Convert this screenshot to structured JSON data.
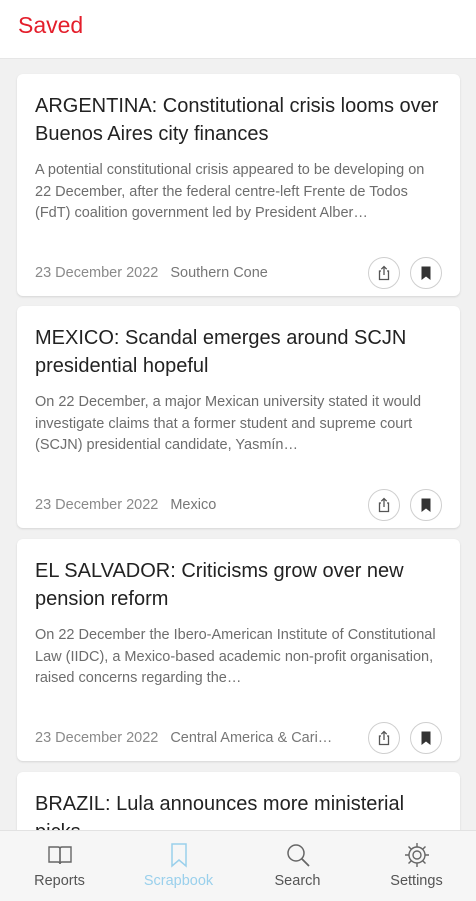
{
  "header": {
    "title": "Saved"
  },
  "colors": {
    "accent": "#e41e2b",
    "active_tab": "#9ad0ec"
  },
  "articles": [
    {
      "title": "ARGENTINA: Constitutional crisis looms over Buenos Aires city finances",
      "summary": "A potential constitutional crisis appeared to be developing on 22 December, after the federal centre-left Frente de Todos (FdT) coalition government led by President Alber…",
      "date": "23 December 2022",
      "region": "Southern Cone"
    },
    {
      "title": "MEXICO: Scandal emerges around SCJN presidential hopeful",
      "summary": "On 22 December, a major Mexican university stated it would investigate claims that a former student and supreme court (SCJN) presidential candidate, Yasmín…",
      "date": "23 December 2022",
      "region": "Mexico"
    },
    {
      "title": "EL SALVADOR: Criticisms grow over new pension reform",
      "summary": "On 22 December the Ibero-American Institute of Constitutional Law (IIDC), a Mexico-based academic non-profit organisation, raised concerns regarding the…",
      "date": "23 December 2022",
      "region": "Central America & Caribbean"
    },
    {
      "title": "BRAZIL: Lula announces more ministerial picks"
    }
  ],
  "tabs": [
    {
      "label": "Reports",
      "icon": "book-icon",
      "active": false
    },
    {
      "label": "Scrapbook",
      "icon": "bookmark-icon",
      "active": true
    },
    {
      "label": "Search",
      "icon": "search-icon",
      "active": false
    },
    {
      "label": "Settings",
      "icon": "gear-icon",
      "active": false
    }
  ]
}
